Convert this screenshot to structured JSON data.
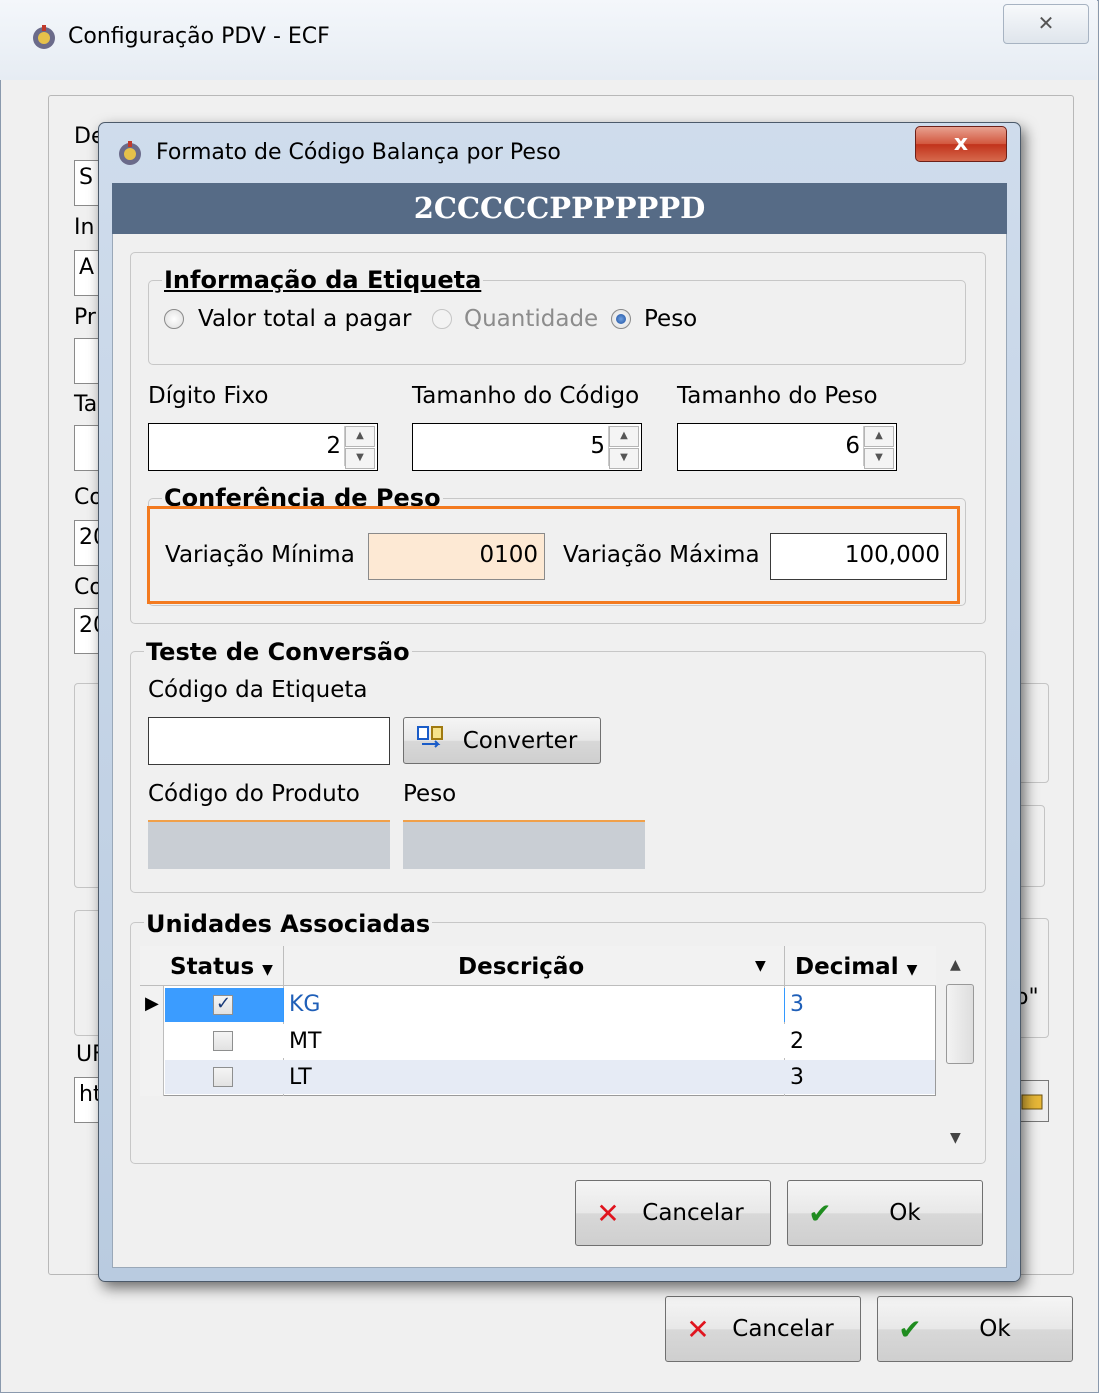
{
  "outer_window": {
    "title": "Configuração PDV - ECF",
    "close_glyph": "✕",
    "peek_labels": [
      "De",
      "In",
      "Pr",
      "Ta",
      "Co",
      "Co",
      "UF"
    ],
    "peek_values": [
      "S",
      "A",
      "20",
      "20",
      "ht"
    ],
    "peek_right_text": "o\"",
    "buttons": {
      "cancel": "Cancelar",
      "ok": "Ok"
    }
  },
  "dialog": {
    "title": "Formato de Código Balança por Peso",
    "close_glyph": "x",
    "code_format": "2CCCCCPPPPPPD",
    "label_info": {
      "title": "Informação da Etiqueta",
      "options": [
        "Valor total a pagar",
        "Quantidade",
        "Peso"
      ],
      "selected": "Peso"
    },
    "fixed_digit": {
      "label": "Dígito Fixo",
      "value": "2"
    },
    "code_size": {
      "label": "Tamanho do Código",
      "value": "5"
    },
    "weight_size": {
      "label": "Tamanho do Peso",
      "value": "6"
    },
    "weight_check": {
      "title": "Conferência de Peso",
      "min_label": "Variação Mínima",
      "min_value": "0100",
      "max_label": "Variação Máxima",
      "max_value": "100,000"
    },
    "conversion_test": {
      "title": "Teste de Conversão",
      "label_code_label": "Código da Etiqueta",
      "label_code_value": "",
      "convert_button": "Converter",
      "product_code_label": "Código do Produto",
      "weight_label": "Peso"
    },
    "units": {
      "title": "Unidades Associadas",
      "columns": [
        "Status",
        "Descrição",
        "Decimal"
      ],
      "rows": [
        {
          "checked": true,
          "description": "KG",
          "decimal": "3"
        },
        {
          "checked": false,
          "description": "MT",
          "decimal": "2"
        },
        {
          "checked": false,
          "description": "LT",
          "decimal": "3"
        }
      ]
    },
    "buttons": {
      "cancel": "Cancelar",
      "ok": "Ok"
    }
  },
  "colors": {
    "header": "#566b86",
    "highlight_border": "#f37a1f",
    "selected_row": "#3399ff",
    "focus_field": "#fde9d4"
  }
}
